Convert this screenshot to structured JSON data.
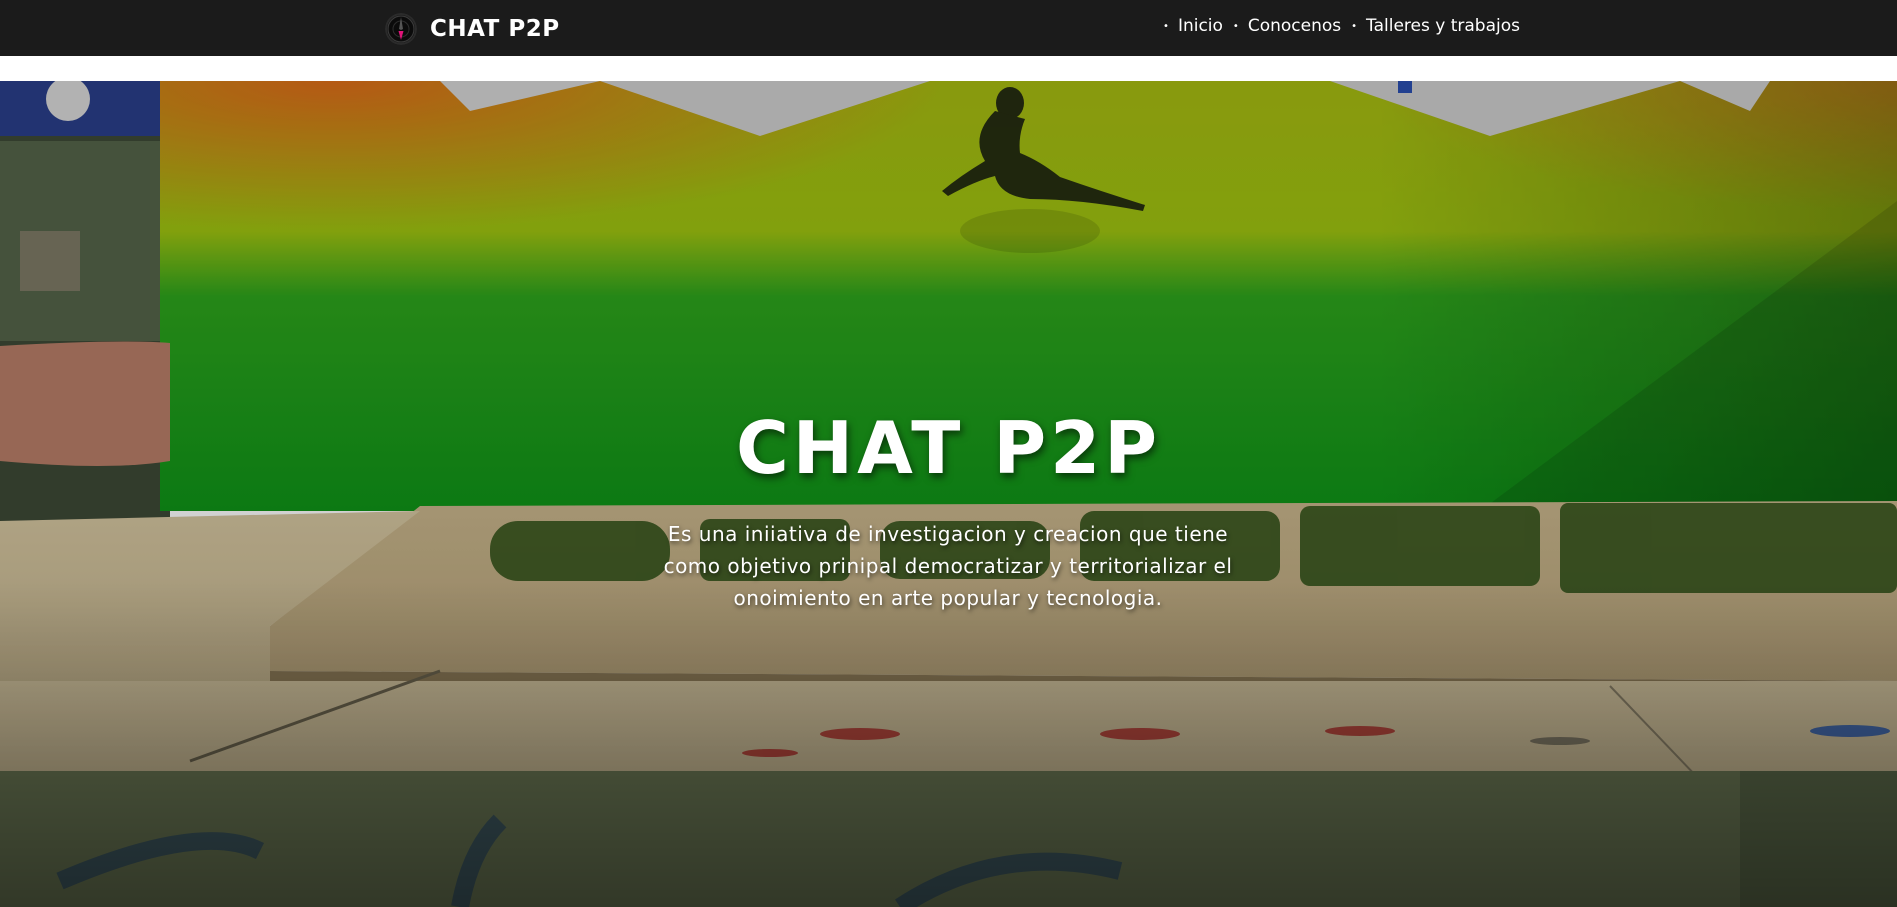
{
  "navbar": {
    "brand": "CHAT P2P",
    "logo_icon": "compass-logo-icon",
    "links": [
      "Inicio",
      "Conocenos",
      "Talleres y trabajos"
    ],
    "bullet": "•"
  },
  "hero": {
    "title": "CHAT P2P",
    "subtitle": "Es una iniiativa de investigacion y creacion que tiene como objetivo prinipal democratizar y territorializar el onoimiento en arte popular y tecnologia."
  },
  "colors": {
    "navbar_bg": "#1b1b1b",
    "text": "#ffffff",
    "accent": "#e0147a"
  }
}
